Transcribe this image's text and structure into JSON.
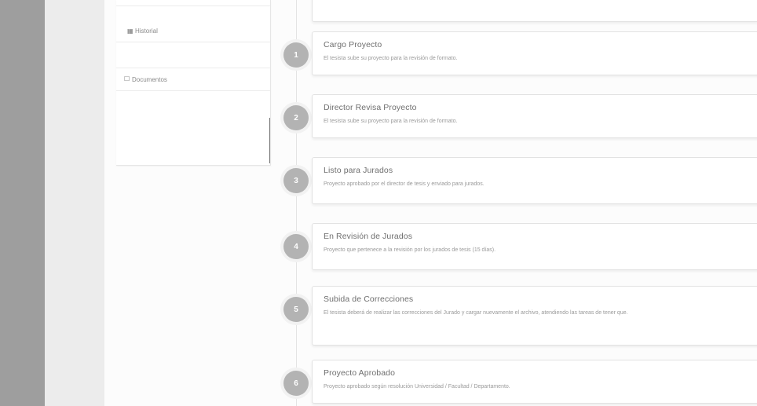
{
  "nav": {
    "items": [
      {
        "label": "Historial",
        "icon": "list-icon"
      },
      {
        "label": "Documentos",
        "icon": "folder-icon"
      }
    ]
  },
  "steps": [
    {
      "number": "1",
      "title": "Cargo Proyecto",
      "description": "El tesista sube su proyecto para la revisión de formato."
    },
    {
      "number": "2",
      "title": "Director Revisa Proyecto",
      "description": "El tesista sube su proyecto para la revisión de formato."
    },
    {
      "number": "3",
      "title": "Listo para Jurados",
      "description": "Proyecto aprobado por el director de tesis y enviado para jurados."
    },
    {
      "number": "4",
      "title": "En Revisión de Jurados",
      "description": "Proyecto que pertenece a la revisión por los jurados de tesis (15 días)."
    },
    {
      "number": "5",
      "title": "Subida de Correcciones",
      "description": "El tesista deberá de realizar las correcciones del Jurado y cargar nuevamente el archivo, atendiendo las tareas de tener que."
    },
    {
      "number": "6",
      "title": "Proyecto Aprobado",
      "description": "Proyecto aprobado según resolución Universidad / Facultad / Departamento."
    }
  ],
  "colors": {
    "sidebar": "#9e9e9e",
    "step_circle": "#b3b3b3",
    "card_border": "#e2e2e2"
  }
}
